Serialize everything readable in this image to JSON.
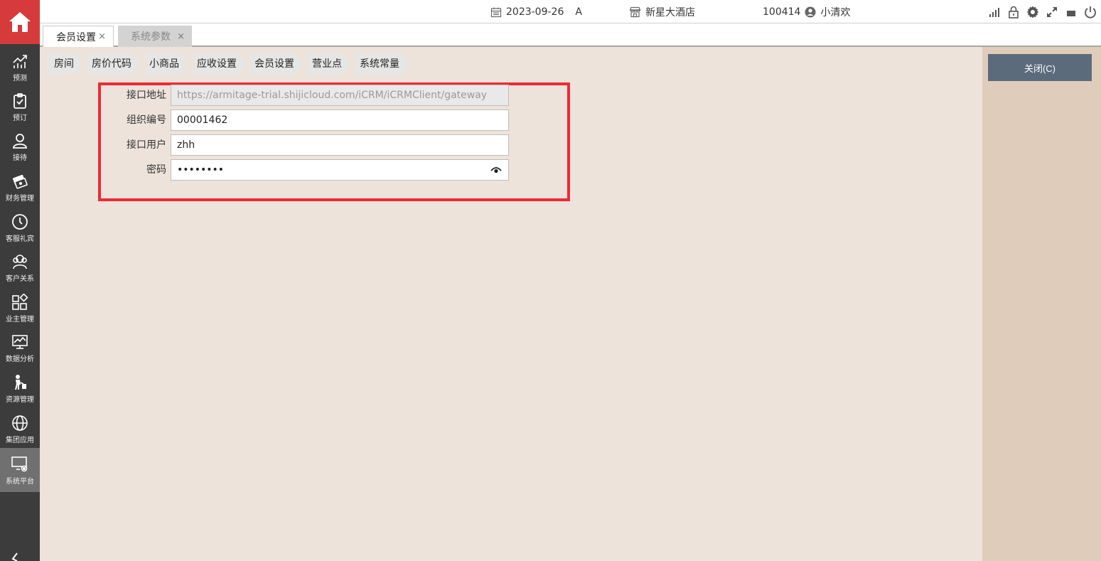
{
  "topbar": {
    "date": "2023-09-26",
    "shift": "A",
    "hotel": "新星大酒店",
    "user_id": "100414",
    "user_name": "小清欢"
  },
  "tabs": [
    {
      "label": "会员设置",
      "close": "×",
      "active": true
    },
    {
      "label": "系统参数",
      "close": "×",
      "active": false
    }
  ],
  "sidebar": {
    "items": [
      {
        "label": "预测",
        "icon": "chart-icon"
      },
      {
        "label": "预订",
        "icon": "clipboard-icon"
      },
      {
        "label": "接待",
        "icon": "person-icon"
      },
      {
        "label": "财务管理",
        "icon": "money-icon"
      },
      {
        "label": "客服礼宾",
        "icon": "clock-icon"
      },
      {
        "label": "客户关系",
        "icon": "people-icon"
      },
      {
        "label": "业主管理",
        "icon": "grid-icon"
      },
      {
        "label": "数据分析",
        "icon": "monitor-chart-icon"
      },
      {
        "label": "资源管理",
        "icon": "worker-icon"
      },
      {
        "label": "集团应用",
        "icon": "globe-icon"
      },
      {
        "label": "系统平台",
        "icon": "screen-gear-icon",
        "active": true
      }
    ]
  },
  "breadcrumbs": [
    "房间",
    "房价代码",
    "小商品",
    "应收设置",
    "会员设置",
    "营业点",
    "系统常量"
  ],
  "form": {
    "api_url_label": "接口地址",
    "api_url_value": "https://armitage-trial.shijicloud.com/iCRM/iCRMClient/gateway",
    "org_label": "组织编号",
    "org_value": "00001462",
    "user_label": "接口用户",
    "user_value": "zhh",
    "password_label": "密码",
    "password_value": "........"
  },
  "actions": {
    "close_label": "关闭(C)"
  },
  "colors": {
    "sidebar_bg": "#3c3c3c",
    "home_red": "#d63a3a",
    "content_bg": "#ede3da",
    "right_panel_bg": "#e0ccba",
    "close_btn_bg": "#5b6b7c",
    "highlight_red": "#ee2a35"
  }
}
